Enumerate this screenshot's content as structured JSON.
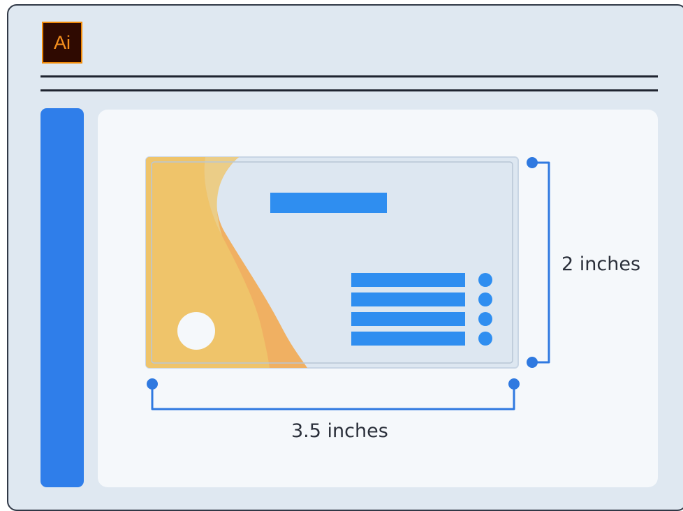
{
  "app": {
    "logo_text": "Ai",
    "logo_colors": {
      "background": "#2f0a01",
      "text": "#f7901e",
      "border": "#f08a0a"
    }
  },
  "card": {
    "colors": {
      "panel": "#dde7f1",
      "accent_orange": "#f0b062",
      "accent_yellow": "#efc46a",
      "bars": "#2f8ef0"
    },
    "info_lines": 4
  },
  "dimensions": {
    "height_label": "2 inches",
    "width_label": "3.5 inches"
  },
  "theme": {
    "sidebar": "#2f7eea",
    "canvas": "#f5f8fb",
    "window": "#dfe8f1",
    "dimension_lines": "#2f79e0"
  }
}
